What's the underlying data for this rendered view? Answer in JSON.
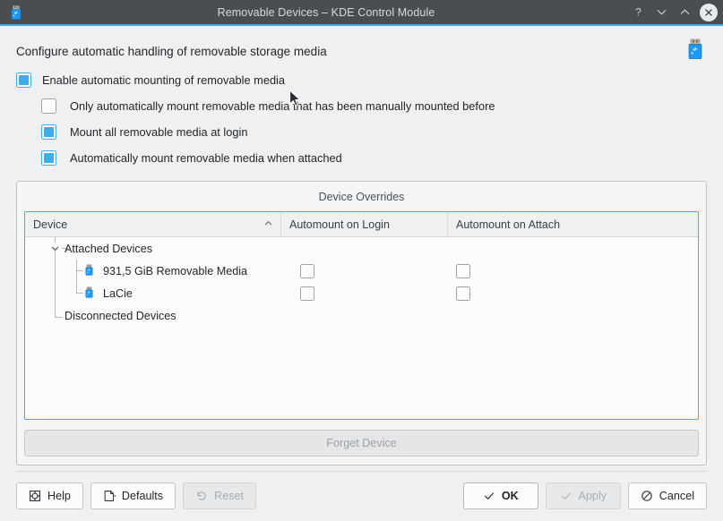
{
  "window": {
    "title": "Removable Devices – KDE Control Module",
    "icon": "usb-drive-icon",
    "controls": {
      "help": "?",
      "minimize": "chevron-down-icon",
      "maximize": "chevron-up-icon",
      "close": "close-icon"
    },
    "colors": {
      "titlebar_bg": "#4a4d52",
      "accent": "#3daee9",
      "window_bg": "#eff0f1",
      "view_bg": "#fcfcfc"
    }
  },
  "header": {
    "description": "Configure automatic handling of removable storage media",
    "icon": "usb-drive-icon"
  },
  "options": [
    {
      "label": "Enable automatic mounting of removable media",
      "checked": true,
      "indent": false,
      "name": "enable-automatic-mounting"
    },
    {
      "label": "Only automatically mount removable media that has been manually mounted before",
      "checked": false,
      "indent": true,
      "name": "only-previously-mounted"
    },
    {
      "label": "Mount all removable media at login",
      "checked": true,
      "indent": true,
      "name": "mount-all-at-login"
    },
    {
      "label": "Automatically mount removable media when attached",
      "checked": true,
      "indent": true,
      "name": "mount-when-attached"
    }
  ],
  "device_overrides": {
    "title": "Device Overrides",
    "columns": [
      {
        "label": "Device",
        "sort": "ascending",
        "sort_indicator": "^"
      },
      {
        "label": "Automount on Login",
        "sort": "none"
      },
      {
        "label": "Automount on Attach",
        "sort": "none"
      }
    ],
    "groups": [
      {
        "label": "Attached Devices",
        "expanded": true,
        "toggle_icon": "chevron-down-icon",
        "devices": [
          {
            "label": "931,5 GiB Removable Media",
            "icon": "usb-drive-icon",
            "automount_on_login": false,
            "automount_on_attach": false
          },
          {
            "label": "LaCie",
            "icon": "usb-drive-icon",
            "automount_on_login": false,
            "automount_on_attach": false
          }
        ]
      },
      {
        "label": "Disconnected Devices",
        "expanded": false,
        "toggle_icon": "none",
        "devices": []
      }
    ],
    "forget_button": {
      "label": "Forget Device",
      "enabled": false
    }
  },
  "footer": {
    "help": {
      "label": "Help",
      "icon": "help-icon",
      "enabled": true
    },
    "defaults": {
      "label": "Defaults",
      "icon": "document-icon",
      "enabled": true
    },
    "reset": {
      "label": "Reset",
      "icon": "undo-icon",
      "enabled": false
    },
    "ok": {
      "label": "OK",
      "icon": "check-icon",
      "enabled": true,
      "default": true
    },
    "apply": {
      "label": "Apply",
      "icon": "check-icon",
      "enabled": false
    },
    "cancel": {
      "label": "Cancel",
      "icon": "cancel-icon",
      "enabled": true
    }
  }
}
